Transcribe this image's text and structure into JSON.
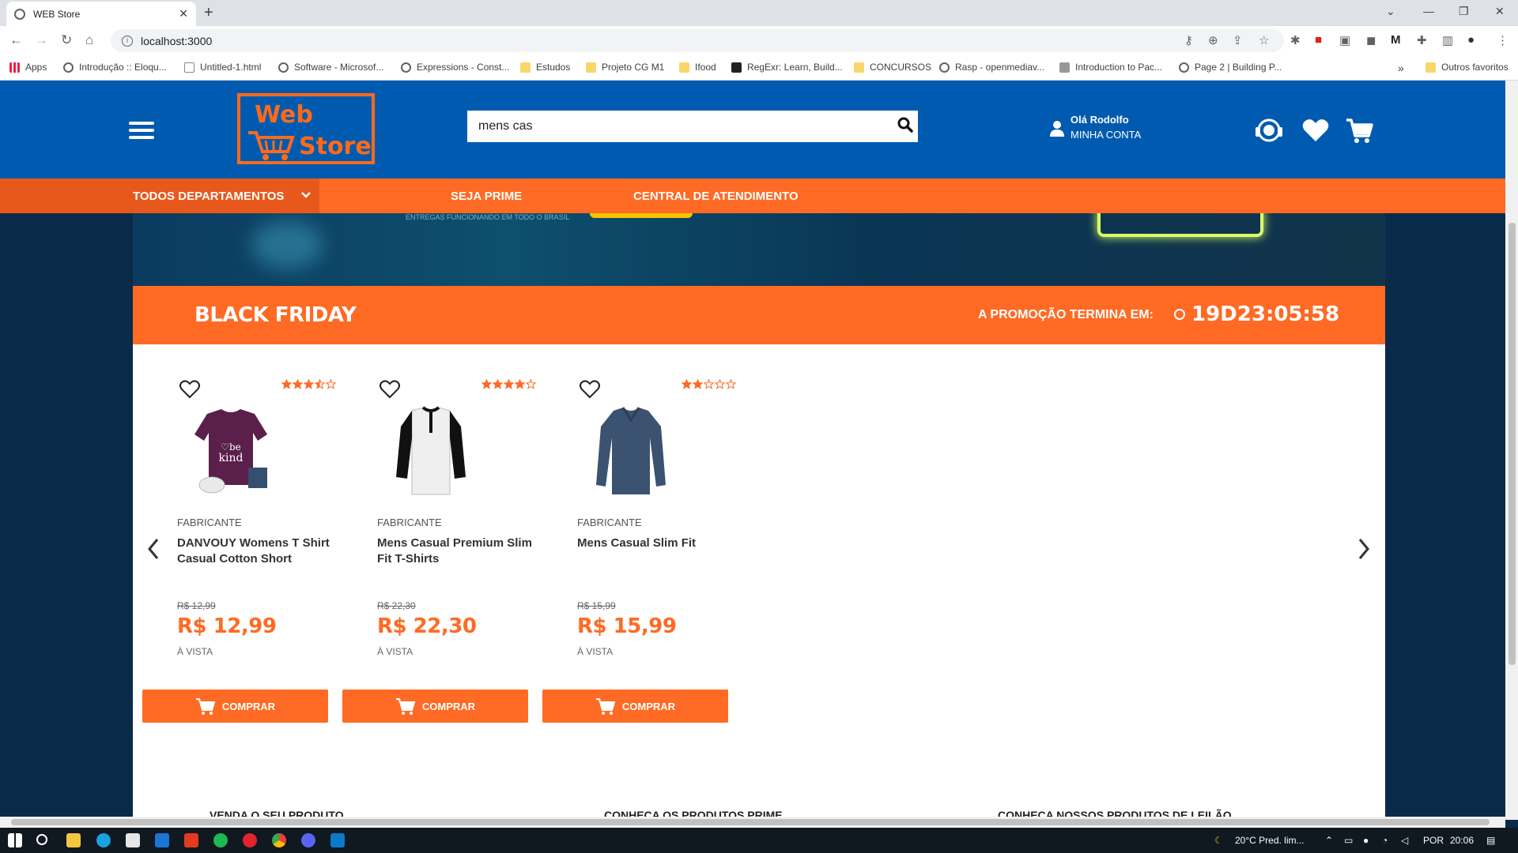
{
  "browser": {
    "tab_title": "WEB Store",
    "tab_close": "✕",
    "new_tab": "+",
    "url": "localhost:3000",
    "window_controls": [
      "⌄",
      "—",
      "❐",
      "✕"
    ],
    "bookmarks": [
      {
        "label": "Apps",
        "icon": "apps-grid-icon"
      },
      {
        "label": "Introdução :: Eloqu...",
        "icon": "globe-icon"
      },
      {
        "label": "Untitled-1.html",
        "icon": "file-icon"
      },
      {
        "label": "Software - Microsof...",
        "icon": "globe-icon"
      },
      {
        "label": "Expressions - Const...",
        "icon": "globe-icon"
      },
      {
        "label": "Estudos",
        "icon": "folder-icon"
      },
      {
        "label": "Projeto CG M1",
        "icon": "folder-icon"
      },
      {
        "label": "Ifood",
        "icon": "folder-icon"
      },
      {
        "label": "RegExr: Learn, Build...",
        "icon": "regexr-icon"
      },
      {
        "label": "CONCURSOS",
        "icon": "folder-icon"
      },
      {
        "label": "Rasp - openmediav...",
        "icon": "globe-icon"
      },
      {
        "label": "Introduction to Pac...",
        "icon": "grid-icon"
      },
      {
        "label": "Page 2 | Building P...",
        "icon": "globe-icon"
      }
    ],
    "bookmarks_more": "»",
    "other_favorites": "Outros favoritos"
  },
  "header": {
    "logo_line1": "Web",
    "logo_line2": "Store",
    "search_value": "mens cas",
    "greeting": "Olá Rodolfo",
    "account_label": "MINHA CONTA"
  },
  "nav": {
    "all_departments": "TODOS DEPARTAMENTOS",
    "prime": "SEJA PRIME",
    "support": "CENTRAL DE ATENDIMENTO"
  },
  "banner": {
    "text": "ENTREGAS FUNCIONANDO EM TODO O BRASIL"
  },
  "promo": {
    "title": "BLACK FRIDAY",
    "ends_label": "A PROMOÇÃO TERMINA EM:",
    "timer": "19D23:05:58"
  },
  "products": [
    {
      "maker": "FABRICANTE",
      "name": "DANVOUY Womens T Shirt Casual Cotton Short",
      "old_price": "R$ 12,99",
      "price": "R$ 12,99",
      "payment": "À VISTA",
      "rating": 3.5,
      "buy_label": "COMPRAR",
      "image": "purple-tshirt"
    },
    {
      "maker": "FABRICANTE",
      "name": "Mens Casual Premium Slim Fit T-Shirts",
      "old_price": "R$ 22,30",
      "price": "R$ 22,30",
      "payment": "À VISTA",
      "rating": 4.0,
      "buy_label": "COMPRAR",
      "image": "raglan-henley"
    },
    {
      "maker": "FABRICANTE",
      "name": "Mens Casual Slim Fit",
      "old_price": "R$ 15,99",
      "price": "R$ 15,99",
      "payment": "À VISTA",
      "rating": 2.0,
      "buy_label": "COMPRAR",
      "image": "blue-longsleeve"
    }
  ],
  "bottom_links": [
    "VENDA O SEU PRODUTO",
    "CONHEÇA OS PRODUTOS PRIME",
    "CONHEÇA NOSSOS PRODUTOS DE LEILÃO"
  ],
  "taskbar": {
    "weather": "20°C  Pred. lim...",
    "lang": "POR",
    "time": "20:06"
  },
  "colors": {
    "header_blue": "#005bb0",
    "accent_orange": "#ff6a24",
    "page_bg": "#0a2a4a"
  }
}
